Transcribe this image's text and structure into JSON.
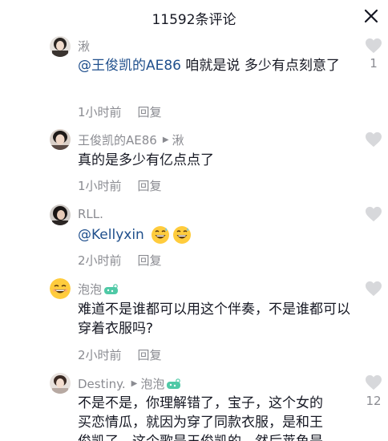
{
  "header": {
    "title": "11592条评论"
  },
  "comments": [
    {
      "name": "湫",
      "mention": "@王俊凯的AE86",
      "text": " 咱就是说 多少有点刻意了",
      "time": "1小时前",
      "reply": "回复",
      "likes": "1"
    },
    {
      "name": "王俊凯的AE86",
      "reply_to": "湫",
      "text": "真的是多少有亿点点了",
      "time": "1小时前",
      "reply": "回复"
    },
    {
      "name": "RLL.",
      "mention": "@Kellyxin",
      "emojis": [
        "grinning-sweat-emoji",
        "grinning-sweat-emoji"
      ],
      "time": "2小时前",
      "reply": "回复"
    },
    {
      "name": "泡泡",
      "text": "难道不是谁都可以用这个伴奏，不是谁都可以穿着衣服吗?",
      "time": "2小时前",
      "reply": "回复"
    },
    {
      "name": "Destiny.",
      "reply_to": "泡泡",
      "text_lines": [
        "不是不是，你理解错了，宝子，这个女的",
        "买恋情瓜，就因为穿了同款衣服，是和王",
        "俊凯了，这个歌是王俊凯的，然后莱鱼是"
      ],
      "likes": "12"
    }
  ],
  "colors": {
    "text": "#161823",
    "muted": "#8a8b91",
    "mention": "#1f4f8c",
    "like_icon": "#d7d8db"
  }
}
